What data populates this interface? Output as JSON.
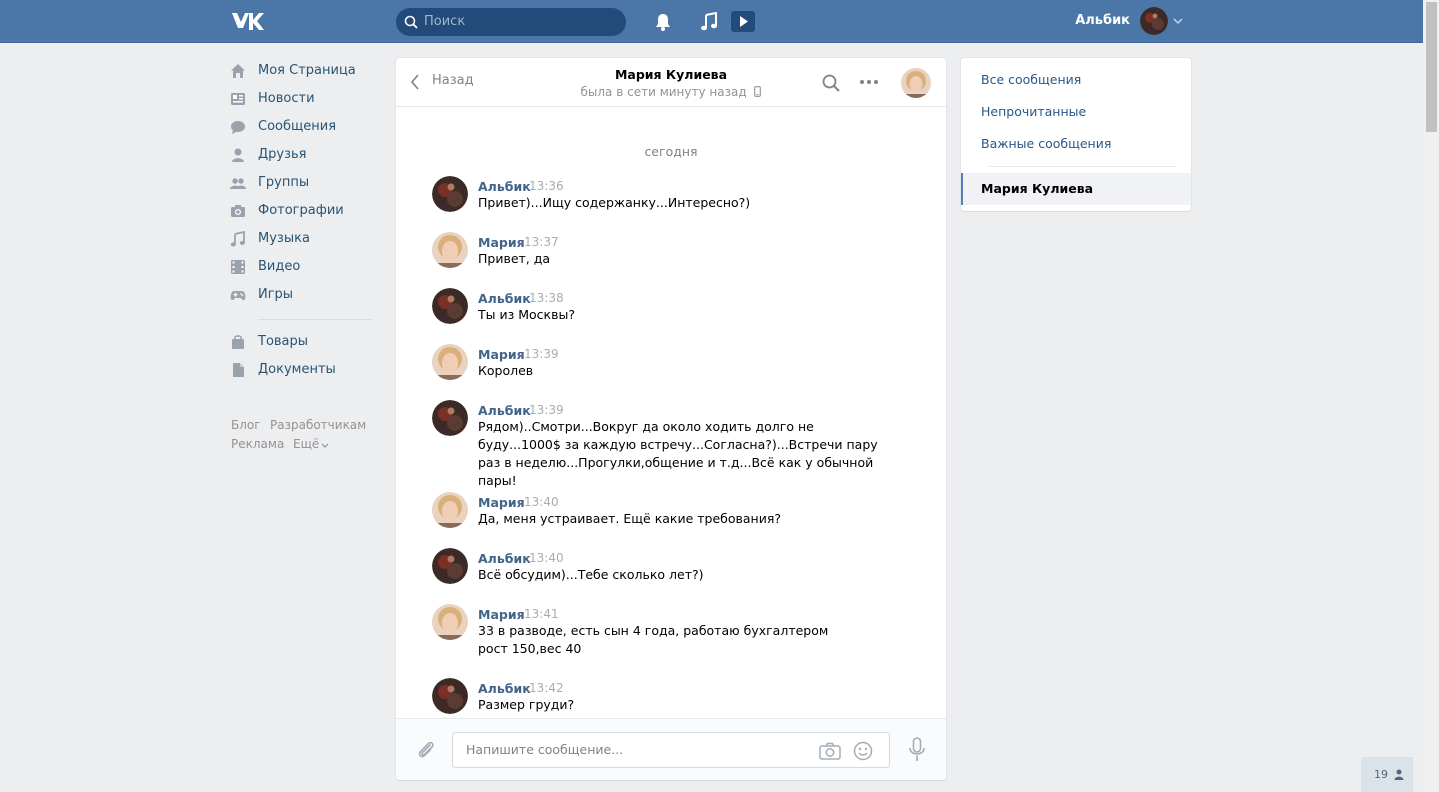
{
  "header": {
    "search_placeholder": "Поиск",
    "username": "Альбик",
    "brand_color": "#4a76a8"
  },
  "sidebar": {
    "items": [
      {
        "label": "Моя Страница",
        "icon": "home-icon"
      },
      {
        "label": "Новости",
        "icon": "news-icon"
      },
      {
        "label": "Сообщения",
        "icon": "messages-icon"
      },
      {
        "label": "Друзья",
        "icon": "friend-icon"
      },
      {
        "label": "Группы",
        "icon": "groups-icon"
      },
      {
        "label": "Фотографии",
        "icon": "camera-icon"
      },
      {
        "label": "Музыка",
        "icon": "music-icon"
      },
      {
        "label": "Видео",
        "icon": "video-icon"
      },
      {
        "label": "Игры",
        "icon": "gamepad-icon"
      },
      {
        "label": "Товары",
        "icon": "shopping-bag-icon"
      },
      {
        "label": "Документы",
        "icon": "document-icon"
      }
    ],
    "footer": {
      "blog": "Блог",
      "developers": "Разработчикам",
      "ads": "Реклама",
      "more": "Ещё"
    }
  },
  "chat": {
    "back_label": "Назад",
    "contact_name": "Мария Кулиева",
    "contact_status": "была в сети минуту назад",
    "day_label": "сегодня",
    "messages": [
      {
        "author": "Альбик",
        "time": "13:36",
        "text": "Привет)...Ищу содержанку...Интересно?)"
      },
      {
        "author": "Мария",
        "time": "13:37",
        "text": "Привет, да"
      },
      {
        "author": "Альбик",
        "time": "13:38",
        "text": "Ты из Москвы?"
      },
      {
        "author": "Мария",
        "time": "13:39",
        "text": "Королев"
      },
      {
        "author": "Альбик",
        "time": "13:39",
        "text": "Рядом)..Смотри...Вокруг да около ходить долго не буду...1000$ за каждую встречу...Согласна?)...Встречи пару раз в неделю...Прогулки,общение и т.д...Всё как у обычной пары!"
      },
      {
        "author": "Мария",
        "time": "13:40",
        "text": "Да, меня устраивает. Ещё какие требования?"
      },
      {
        "author": "Альбик",
        "time": "13:40",
        "text": "Всё обсудим)...Тебе сколько лет?)"
      },
      {
        "author": "Мария",
        "time": "13:41",
        "text": "33 в разводе, есть сын 4 года, работаю бухгалтером рост 150,вес 40"
      },
      {
        "author": "Альбик",
        "time": "13:42",
        "text": "Размер груди?"
      }
    ],
    "composer_placeholder": "Напишите сообщение..."
  },
  "filters": {
    "all": "Все сообщения",
    "unread": "Непрочитанные",
    "important": "Важные сообщения",
    "active_dialog": "Мария Кулиева"
  },
  "online_count": "19"
}
